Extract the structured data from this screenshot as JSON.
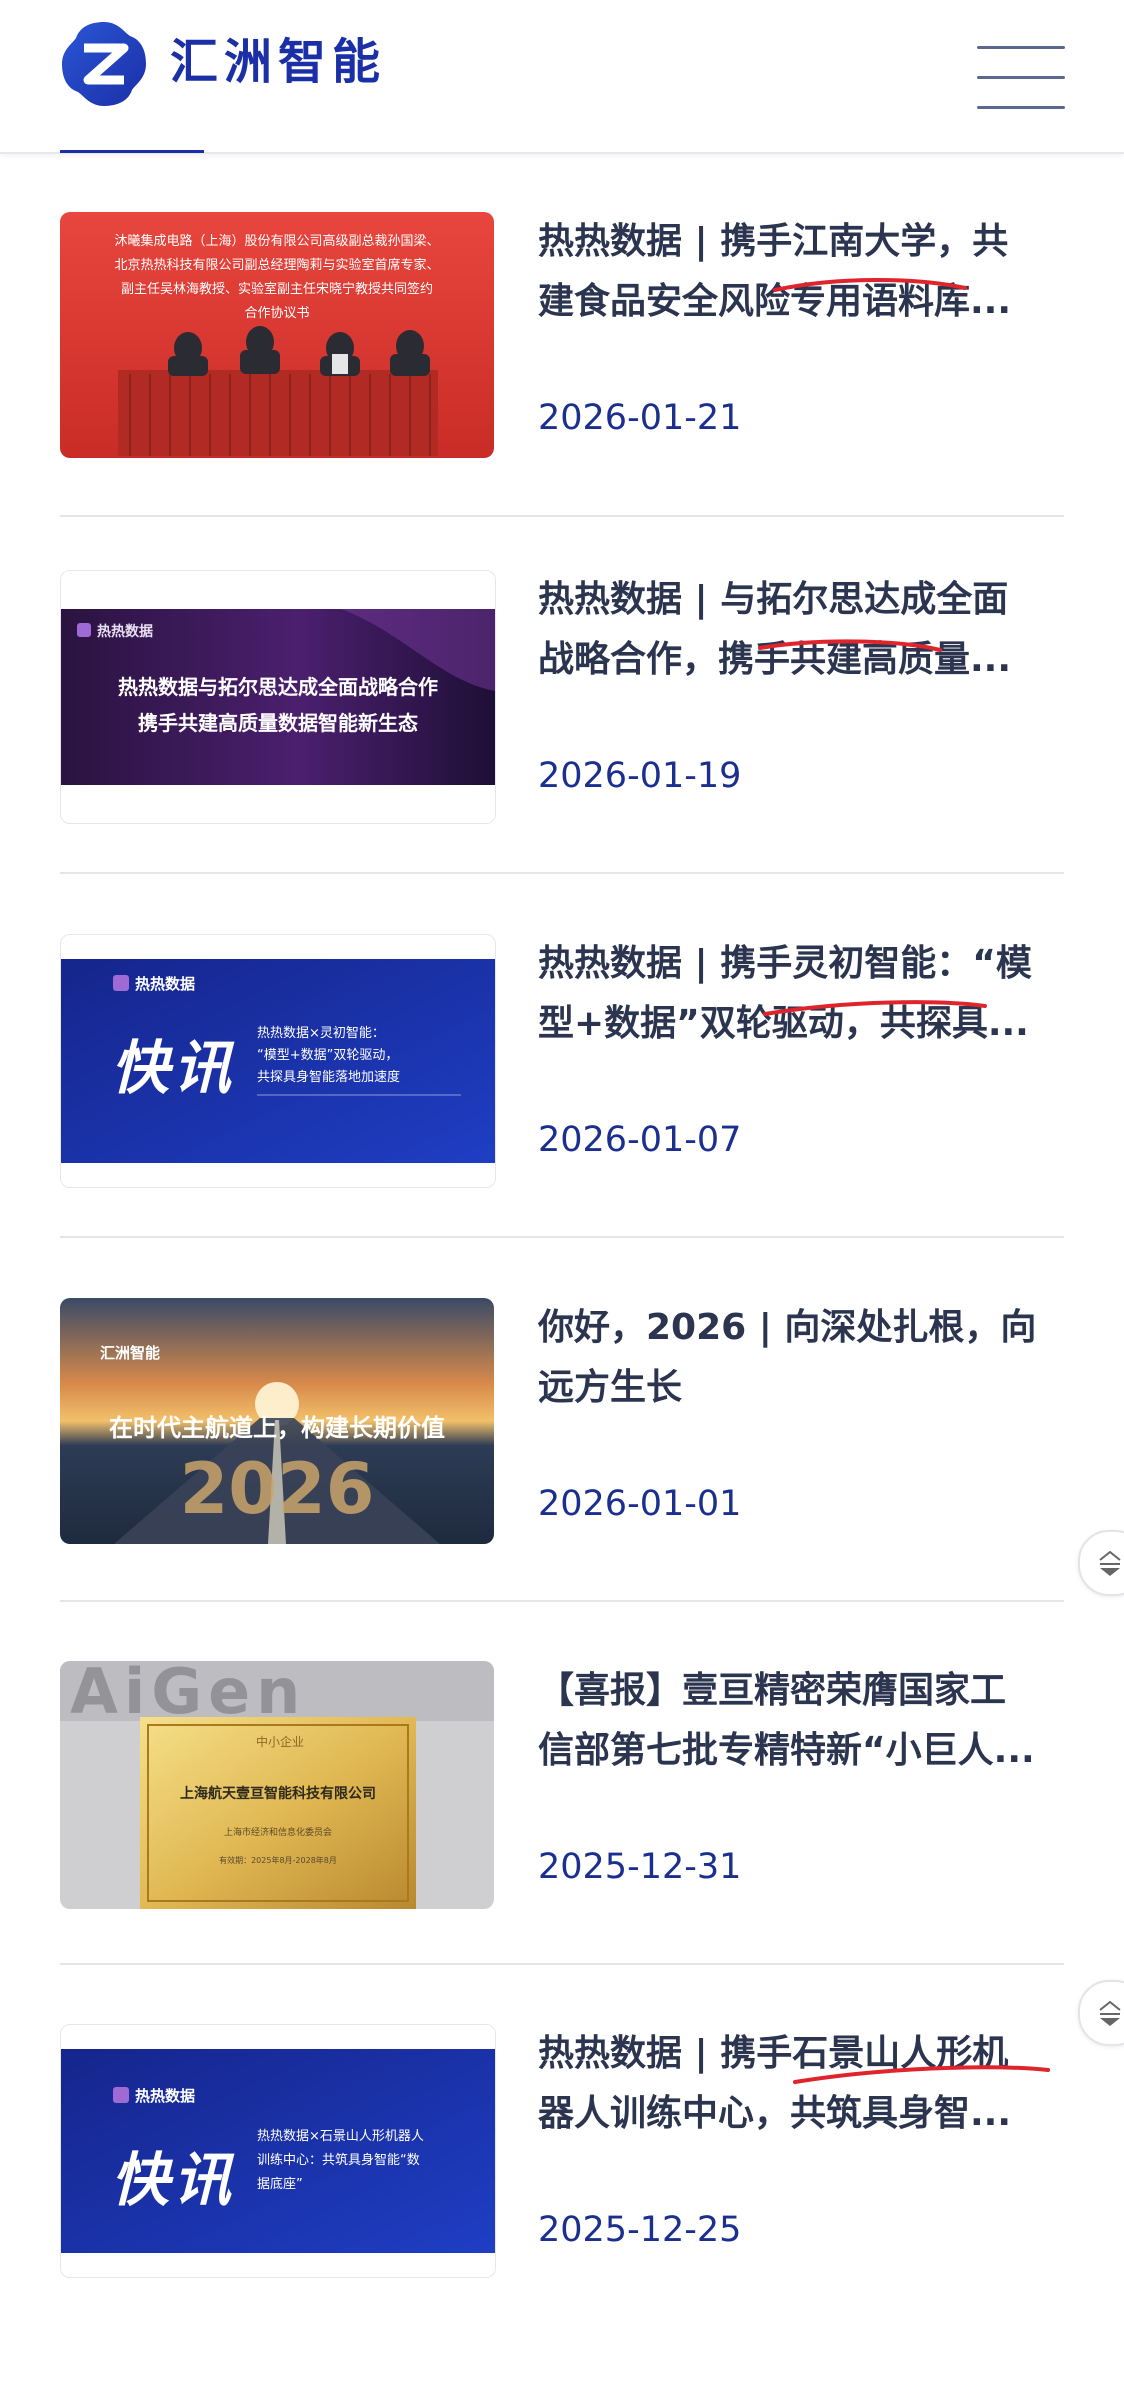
{
  "header": {
    "brand_name": "汇洲智能",
    "menu_icon": "hamburger-menu-icon",
    "logo_icon": "huizhou-logo-icon"
  },
  "colors": {
    "brand": "#1b2fa6",
    "title": "#2c3550",
    "date": "#1b2f8f",
    "underline": "#e0242c"
  },
  "news": [
    {
      "title_line1": "热热数据 | 携手江南大学，共",
      "title_line2": "建食品安全风险专用语料库...",
      "date": "2026-01-21",
      "thumb": {
        "lines": [
          "沐曦集成电路（上海）股份有限公司高级副总裁孙国梁、",
          "北京热热科技有限公司副总经理陶莉与实验室首席专家、",
          "副主任吴林海教授、实验室副主任宋晓宁教授共同签约",
          "合作协议书"
        ]
      }
    },
    {
      "title_line1": "热热数据 | 与拓尔思达成全面",
      "title_line2": "战略合作，携手共建高质量...",
      "date": "2026-01-19",
      "thumb": {
        "brand": "热热数据",
        "line1": "热热数据与拓尔思达成全面战略合作",
        "line2": "携手共建高质量数据智能新生态"
      }
    },
    {
      "title_line1": "热热数据 | 携手灵初智能：“模",
      "title_line2": "型+数据”双轮驱动，共探具...",
      "date": "2026-01-07",
      "thumb": {
        "brand": "热热数据",
        "big": "快讯",
        "line1": "热热数据×灵初智能：",
        "line2": "“模型+数据”双轮驱动，",
        "line3": "共探具身智能落地加速度"
      }
    },
    {
      "title_line1": "你好，2026 | 向深处扎根，向",
      "title_line2": "远方生长",
      "date": "2026-01-01",
      "thumb": {
        "brand": "汇洲智能",
        "headline": "在时代主航道上，构建长期价值",
        "year": "2026"
      }
    },
    {
      "title_line1": "【喜报】壹亘精密荣膺国家工",
      "title_line2": "信部第七批专精特新“小巨人...",
      "date": "2025-12-31",
      "thumb": {
        "wall_text": "AiGen",
        "badge": "中小企业",
        "company": "上海航天壹亘智能科技有限公司",
        "issuer": "上海市经济和信息化委员会",
        "validity": "有效期：2025年8月-2028年8月"
      }
    },
    {
      "title_line1": "热热数据 | 携手石景山人形机",
      "title_line2": "器人训练中心，共筑具身智...",
      "date": "2025-12-25",
      "thumb": {
        "brand": "热热数据",
        "big": "快讯",
        "line1": "热热数据×石景山人形机器人",
        "line2": "训练中心：共筑具身智能“数",
        "line3": "据底座”"
      }
    }
  ]
}
